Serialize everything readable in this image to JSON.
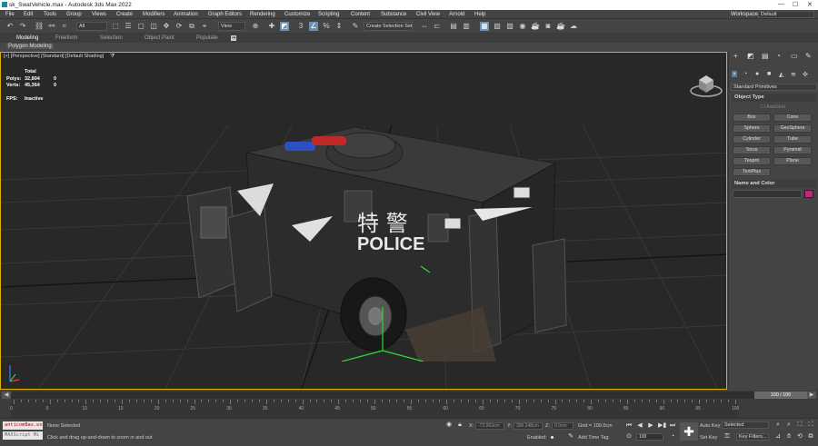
{
  "window": {
    "title": "sk_SwatVehicle.max - Autodesk 3ds Max 2022",
    "minimize": "—",
    "maximize": "☐",
    "close": "✕"
  },
  "menu": [
    "File",
    "Edit",
    "Tools",
    "Group",
    "Views",
    "Create",
    "Modifiers",
    "Animation",
    "Graph Editors",
    "Rendering",
    "Customize",
    "Scripting",
    "Content",
    "Substance",
    "Civil View",
    "Arnold",
    "Help"
  ],
  "workspaces": {
    "label": "Workspaces:",
    "value": "Default"
  },
  "toolbar": {
    "filter": "All",
    "refcoord": "View",
    "selection_set": "Create Selection Set"
  },
  "ribbon": {
    "tabs": [
      "Modeling",
      "Freeform",
      "Selection",
      "Object Paint",
      "Populate"
    ],
    "active": "Modeling",
    "sub": "Polygon Modeling"
  },
  "viewport": {
    "label": "[+] [Perspective] [Standard] [Default Shading]",
    "stats": {
      "total": "Total",
      "polys_label": "Polys:",
      "polys_total": "32,804",
      "polys_sel": "0",
      "verts_label": "Verts:",
      "verts_total": "45,364",
      "verts_sel": "0",
      "fps_label": "FPS:",
      "fps_value": "Inactive"
    },
    "decal_chars": "特 警",
    "decal_text": "POLICE"
  },
  "command_panel": {
    "dropdown": "Standard Primitives",
    "object_type": "Object Type",
    "autogrid": "AutoGrid",
    "buttons": [
      "Box",
      "Cone",
      "Sphere",
      "GeoSphere",
      "Cylinder",
      "Tube",
      "Torus",
      "Pyramid",
      "Teapot",
      "Plane",
      "TextPlus"
    ],
    "name_color": "Name and Color",
    "color_swatch": "#c2297a"
  },
  "timeline": {
    "slider": "100 / 100",
    "ticks": [
      "0",
      "5",
      "10",
      "15",
      "20",
      "25",
      "30",
      "35",
      "40",
      "45",
      "50",
      "55",
      "60",
      "65",
      "70",
      "75",
      "80",
      "85",
      "90",
      "95",
      "100"
    ]
  },
  "status": {
    "script_line1": "anticomBas.exec",
    "script_line2": "MAXScript Mi",
    "selection": "None Selected",
    "prompt": "Click and drag up-and-down to zoom in and out",
    "x_label": "X:",
    "x_val": "-72.063cm",
    "y_label": "Y:",
    "y_val": "396.248cm",
    "z_label": "Z:",
    "z_val": "0.0cm",
    "grid": "Grid = 100.0cm",
    "enabled": "Enabled:",
    "add_time_tag": "Add Time Tag",
    "auto_key": "Auto Key",
    "set_key": "Set Key",
    "selected": "Selected",
    "key_filters": "Key Filters...",
    "frame": "100",
    "frame2": "0"
  }
}
